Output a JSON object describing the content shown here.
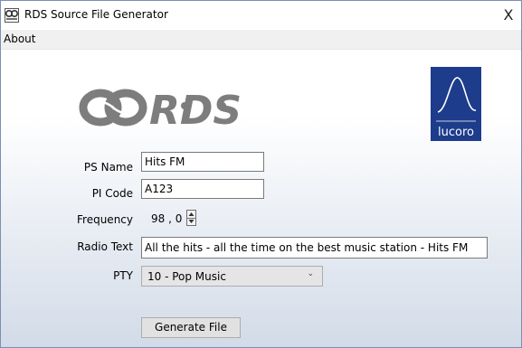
{
  "window": {
    "title": "RDS Source File Generator",
    "close_label": "X"
  },
  "menu": {
    "about": "About"
  },
  "logos": {
    "rds": "RDS",
    "lucoro": "lucoro"
  },
  "form": {
    "ps_name": {
      "label": "PS Name",
      "value": "Hits FM"
    },
    "pi_code": {
      "label": "PI Code",
      "value": "A123"
    },
    "frequency": {
      "label": "Frequency",
      "value": "98 , 0"
    },
    "radio_text": {
      "label": "Radio Text",
      "value": "All the hits - all the time on the best music station - Hits FM"
    },
    "pty": {
      "label": "PTY",
      "value": "10 - Pop Music"
    },
    "generate_button": "Generate File"
  },
  "colors": {
    "logo_grey": "#7d7d7d",
    "lucoro_blue": "#1e3c8c",
    "gradient_bottom": "#d2dbe8"
  }
}
